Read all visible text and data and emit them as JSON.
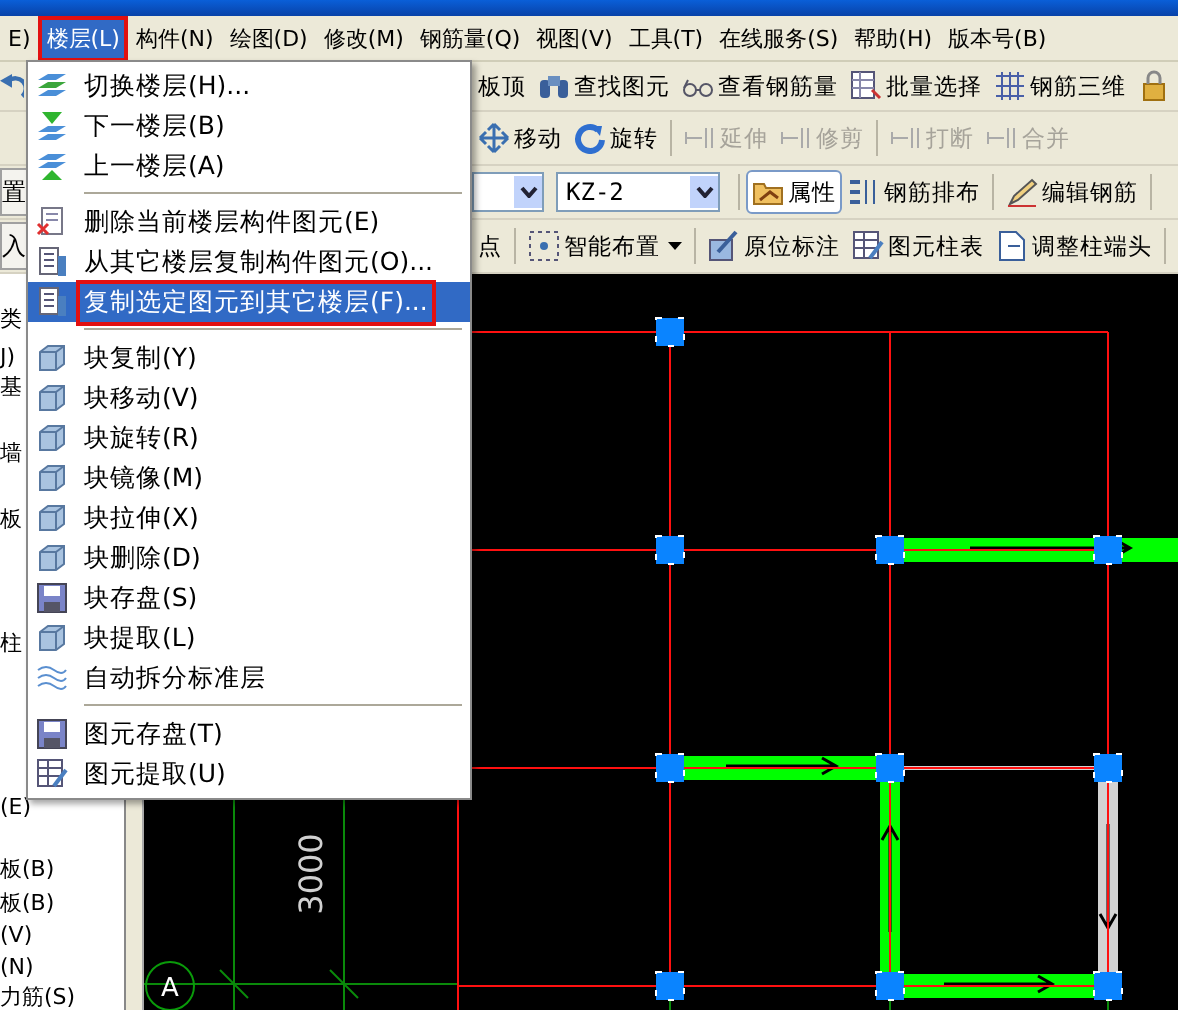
{
  "menu_bar": [
    {
      "label": "E)",
      "selected": false
    },
    {
      "label": "楼层(L)",
      "selected": true
    },
    {
      "label": "构件(N)",
      "selected": false
    },
    {
      "label": "绘图(D)",
      "selected": false
    },
    {
      "label": "修改(M)",
      "selected": false
    },
    {
      "label": "钢筋量(Q)",
      "selected": false
    },
    {
      "label": "视图(V)",
      "selected": false
    },
    {
      "label": "工具(T)",
      "selected": false
    },
    {
      "label": "在线服务(S)",
      "selected": false
    },
    {
      "label": "帮助(H)",
      "selected": false
    },
    {
      "label": "版本号(B)",
      "selected": false
    }
  ],
  "toolbars": [
    [
      {
        "kind": "button",
        "label": "板顶"
      },
      {
        "kind": "button",
        "label": "查找图元"
      },
      {
        "kind": "button",
        "label": "查看钢筋量"
      },
      {
        "kind": "button",
        "label": "批量选择"
      },
      {
        "kind": "button",
        "label": "钢筋三维"
      },
      {
        "kind": "icon_button"
      }
    ],
    [
      {
        "kind": "button",
        "label": "移动",
        "disabled": false
      },
      {
        "kind": "button",
        "label": "旋转",
        "disabled": false
      },
      {
        "kind": "separator"
      },
      {
        "kind": "button",
        "label": "延伸",
        "disabled": true
      },
      {
        "kind": "button",
        "label": "修剪",
        "disabled": true
      },
      {
        "kind": "separator"
      },
      {
        "kind": "button",
        "label": "打断",
        "disabled": true
      },
      {
        "kind": "button",
        "label": "合并",
        "disabled": true
      }
    ],
    [
      {
        "kind": "dropdown"
      },
      {
        "kind": "dropdown",
        "value": "KZ-2"
      },
      {
        "kind": "separator"
      },
      {
        "kind": "button",
        "label": "属性",
        "pressed": true
      },
      {
        "kind": "button",
        "label": "钢筋排布",
        "pressed": false
      },
      {
        "kind": "separator"
      },
      {
        "kind": "button",
        "label": "编辑钢筋",
        "pressed": false
      },
      {
        "kind": "separator"
      }
    ],
    [
      {
        "kind": "button",
        "label": "点"
      },
      {
        "kind": "separator"
      },
      {
        "kind": "menu_button",
        "label": "智能布置"
      },
      {
        "kind": "separator"
      },
      {
        "kind": "button",
        "label": "原位标注"
      },
      {
        "kind": "button",
        "label": "图元柱表"
      },
      {
        "kind": "button",
        "label": "调整柱端头"
      },
      {
        "kind": "separator"
      }
    ]
  ],
  "left_panel": {
    "buttons": [
      "置",
      "入"
    ],
    "tree": [
      {
        "label": "类"
      },
      {
        "label": "J)"
      },
      {
        "label": "基"
      },
      {
        "label": "墙"
      },
      {
        "label": "板"
      },
      {
        "label": "柱"
      },
      {
        "label": "(E)"
      },
      {
        "label": "板(B)"
      },
      {
        "label": "板(B)"
      },
      {
        "label": "(V)"
      },
      {
        "label": "(N)"
      },
      {
        "label": "力筋(S)"
      }
    ]
  },
  "floor_menu": {
    "items": [
      {
        "kind": "item",
        "label": "切换楼层(H)...",
        "selected": false
      },
      {
        "kind": "item",
        "label": "下一楼层(B)",
        "selected": false
      },
      {
        "kind": "item",
        "label": "上一楼层(A)",
        "selected": false
      },
      {
        "kind": "separator"
      },
      {
        "kind": "item",
        "label": "删除当前楼层构件图元(E)",
        "selected": false
      },
      {
        "kind": "item",
        "label": "从其它楼层复制构件图元(O)...",
        "selected": false
      },
      {
        "kind": "item",
        "label": "复制选定图元到其它楼层(F)...",
        "selected": true
      },
      {
        "kind": "separator"
      },
      {
        "kind": "item",
        "label": "块复制(Y)",
        "selected": false
      },
      {
        "kind": "item",
        "label": "块移动(V)",
        "selected": false
      },
      {
        "kind": "item",
        "label": "块旋转(R)",
        "selected": false
      },
      {
        "kind": "item",
        "label": "块镜像(M)",
        "selected": false
      },
      {
        "kind": "item",
        "label": "块拉伸(X)",
        "selected": false
      },
      {
        "kind": "item",
        "label": "块删除(D)",
        "selected": false
      },
      {
        "kind": "item",
        "label": "块存盘(S)",
        "selected": false
      },
      {
        "kind": "item",
        "label": "块提取(L)",
        "selected": false
      },
      {
        "kind": "item",
        "label": "自动拆分标准层",
        "selected": false
      },
      {
        "kind": "separator"
      },
      {
        "kind": "item",
        "label": "图元存盘(T)",
        "selected": false
      },
      {
        "kind": "item",
        "label": "图元提取(U)",
        "selected": false
      }
    ]
  },
  "canvas": {
    "dimension": "3000",
    "axis_label": "A"
  }
}
